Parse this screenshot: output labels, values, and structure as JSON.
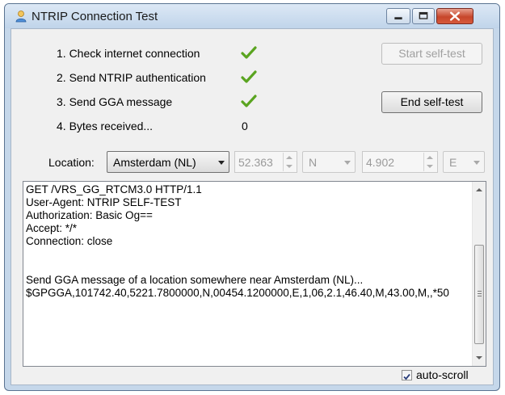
{
  "window": {
    "title": "NTRIP Connection Test",
    "icons": {
      "app": "user-icon",
      "minimize": "minimize-icon",
      "maximize": "maximize-icon",
      "close": "close-icon"
    }
  },
  "steps": [
    {
      "label": "1. Check internet connection",
      "status": "checkmark-icon"
    },
    {
      "label": "2. Send NTRIP authentication",
      "status": "checkmark-icon"
    },
    {
      "label": "3. Send GGA message",
      "status": "checkmark-icon"
    },
    {
      "label": "4. Bytes received...",
      "value": "0"
    }
  ],
  "buttons": {
    "start_self_test": {
      "label": "Start self-test",
      "enabled": false
    },
    "end_self_test": {
      "label": "End self-test",
      "enabled": true
    }
  },
  "location": {
    "label": "Location:",
    "selected": "Amsterdam (NL)",
    "latitude": "52.363",
    "lat_hemisphere": "N",
    "longitude": "4.902",
    "lon_hemisphere": "E"
  },
  "log": {
    "text": "GET /VRS_GG_RTCM3.0 HTTP/1.1\nUser-Agent: NTRIP SELF-TEST\nAuthorization: Basic Og==\nAccept: */*\nConnection: close\n\n\nSend GGA message of a location somewhere near Amsterdam (NL)...\n$GPGGA,101742.40,5221.7800000,N,00454.1200000,E,1,06,2.1,46.40,M,43.00,M,,*50"
  },
  "autoscroll": {
    "label": "auto-scroll",
    "checked": true
  },
  "colors": {
    "check_green": "#5aa420",
    "window_frame": "#c5d7ea",
    "close_red": "#c7462b"
  }
}
